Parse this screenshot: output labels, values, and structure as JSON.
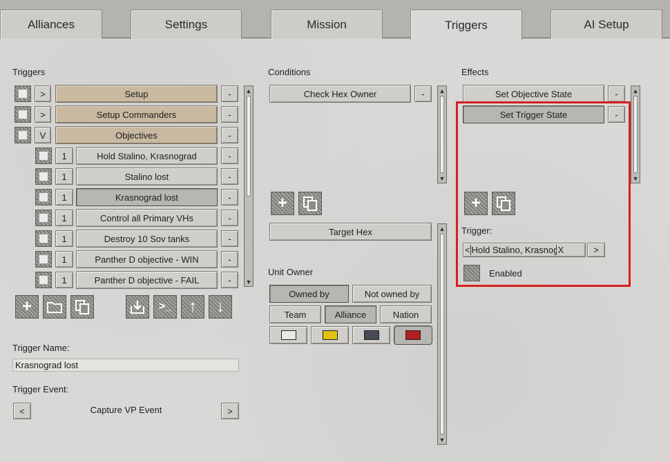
{
  "tabs": [
    {
      "label": "Alliances"
    },
    {
      "label": "Settings"
    },
    {
      "label": "Mission"
    },
    {
      "label": "Triggers"
    },
    {
      "label": "AI Setup"
    }
  ],
  "triggers": {
    "header": "Triggers",
    "groups": [
      {
        "expander": ">",
        "label": "Setup"
      },
      {
        "expander": ">",
        "label": "Setup Commanders"
      },
      {
        "expander": "V",
        "label": "Objectives"
      }
    ],
    "items": [
      {
        "num": "1",
        "label": "Hold Stalino, Krasnograd"
      },
      {
        "num": "1",
        "label": "Stalino lost"
      },
      {
        "num": "1",
        "label": "Krasnograd lost"
      },
      {
        "num": "1",
        "label": "Control all Primary VHs"
      },
      {
        "num": "1",
        "label": "Destroy 10 Sov tanks"
      },
      {
        "num": "1",
        "label": "Panther D  objective - WIN"
      },
      {
        "num": "1",
        "label": "Panther D  objective - FAIL"
      }
    ],
    "remove_label": "-",
    "toolbar": {
      "add": "+",
      "folder": "folder-icon",
      "copy": "copy-icon",
      "import": "import-icon",
      "console": ">_",
      "up": "↑",
      "down": "↓"
    },
    "name_label": "Trigger Name:",
    "name_value": "Krasnograd lost",
    "event_label": "Trigger Event:",
    "event_value": "Capture VP Event",
    "prev": "<",
    "next": ">"
  },
  "conditions": {
    "header": "Conditions",
    "items": [
      {
        "label": "Check Hex Owner"
      }
    ],
    "remove_label": "-",
    "target_hex": "Target Hex",
    "unit_owner_label": "Unit Owner",
    "owned_by": "Owned by",
    "not_owned_by": "Not owned by",
    "team": "Team",
    "alliance": "Alliance",
    "nation": "Nation",
    "colors": [
      "#e8e8e8",
      "#e0c010",
      "#454c55",
      "#b31f1f"
    ]
  },
  "effects": {
    "header": "Effects",
    "items": [
      {
        "label": "Set Objective State"
      },
      {
        "label": "Set Trigger State"
      }
    ],
    "remove_label": "-",
    "trigger_label": "Trigger:",
    "trigger_prev": "<",
    "trigger_value": "Hold Stalino, Krasnogra",
    "trigger_clear": "X",
    "trigger_next": ">",
    "enabled_label": "Enabled"
  },
  "highlight_color": "#d61e1e"
}
